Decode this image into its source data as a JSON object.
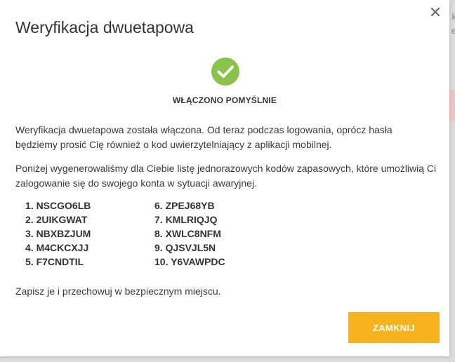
{
  "modal": {
    "title": "Weryfikacja dwuetapowa",
    "close_icon": "close-icon",
    "check_icon": "check-circle-icon",
    "success_color": "#8bc34a",
    "success_label": "WŁĄCZONO POMYŚLNIE",
    "paragraph_1": "Weryfikacja dwuetapowa została włączona. Od teraz podczas logowania, oprócz hasła będziemy prosić Cię również o kod uwierzytelniający z aplikacji mobilnej.",
    "paragraph_2": "Poniżej wygenerowaliśmy dla Ciebie listę jednorazowych kodów zapasowych, które umożliwią Ci zalogowanie się do swojego konta w sytuacji awaryjnej.",
    "backup_codes": [
      "1. NSCGO6LB",
      "2. 2UIKGWAT",
      "3. NBXBZJUM",
      "4. M4CKCXJJ",
      "5. F7CNDTIL",
      "6. ZPEJ68YB",
      "7. KMLRIQJQ",
      "8. XWLC8NFM",
      "9. QJSVJL5N",
      "10. Y6VAWPDC"
    ],
    "paragraph_3": "Zapisz je i przechowuj w bezpiecznym miejscu.",
    "close_button_label": "ZAMKNIJ",
    "accent_color": "#f7b31e"
  },
  "background": {
    "peek_text_1": "k",
    "peek_text_2": "e"
  }
}
